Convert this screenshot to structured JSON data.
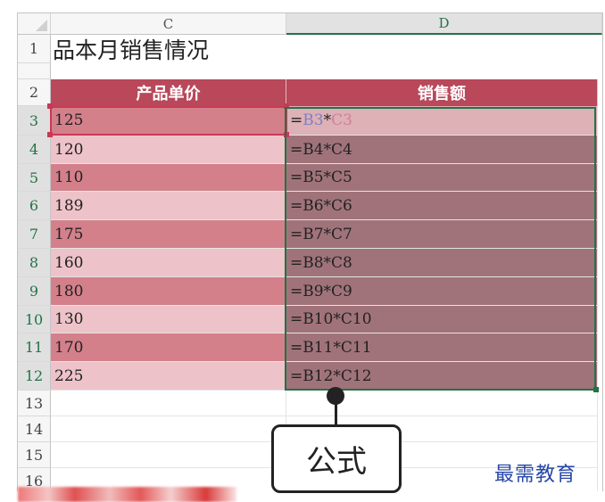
{
  "columns": {
    "c": "C",
    "d": "D"
  },
  "title": "品本月销售情况",
  "headers": {
    "price": "产品单价",
    "sales": "销售额"
  },
  "rows": [
    {
      "row": "3",
      "price": "125",
      "f_eq": "=",
      "f_b": "B3",
      "f_op": "*",
      "f_c": "C3"
    },
    {
      "row": "4",
      "price": "120",
      "formula": "=B4*C4"
    },
    {
      "row": "5",
      "price": "110",
      "formula": "=B5*C5"
    },
    {
      "row": "6",
      "price": "189",
      "formula": "=B6*C6"
    },
    {
      "row": "7",
      "price": "175",
      "formula": "=B7*C7"
    },
    {
      "row": "8",
      "price": "160",
      "formula": "=B8*C8"
    },
    {
      "row": "9",
      "price": "180",
      "formula": "=B9*C9"
    },
    {
      "row": "10",
      "price": "130",
      "formula": "=B10*C10"
    },
    {
      "row": "11",
      "price": "170",
      "formula": "=B11*C11"
    },
    {
      "row": "12",
      "price": "225",
      "formula": "=B12*C12"
    }
  ],
  "row_labels": {
    "r1": "1",
    "r2": "2",
    "r13": "13",
    "r14": "14",
    "r15": "15",
    "r16": "16"
  },
  "callout": "公式",
  "watermark": "最需教育",
  "colors": {
    "header": "#b8485a",
    "selection": "#217346",
    "reference": "#c73a55"
  }
}
